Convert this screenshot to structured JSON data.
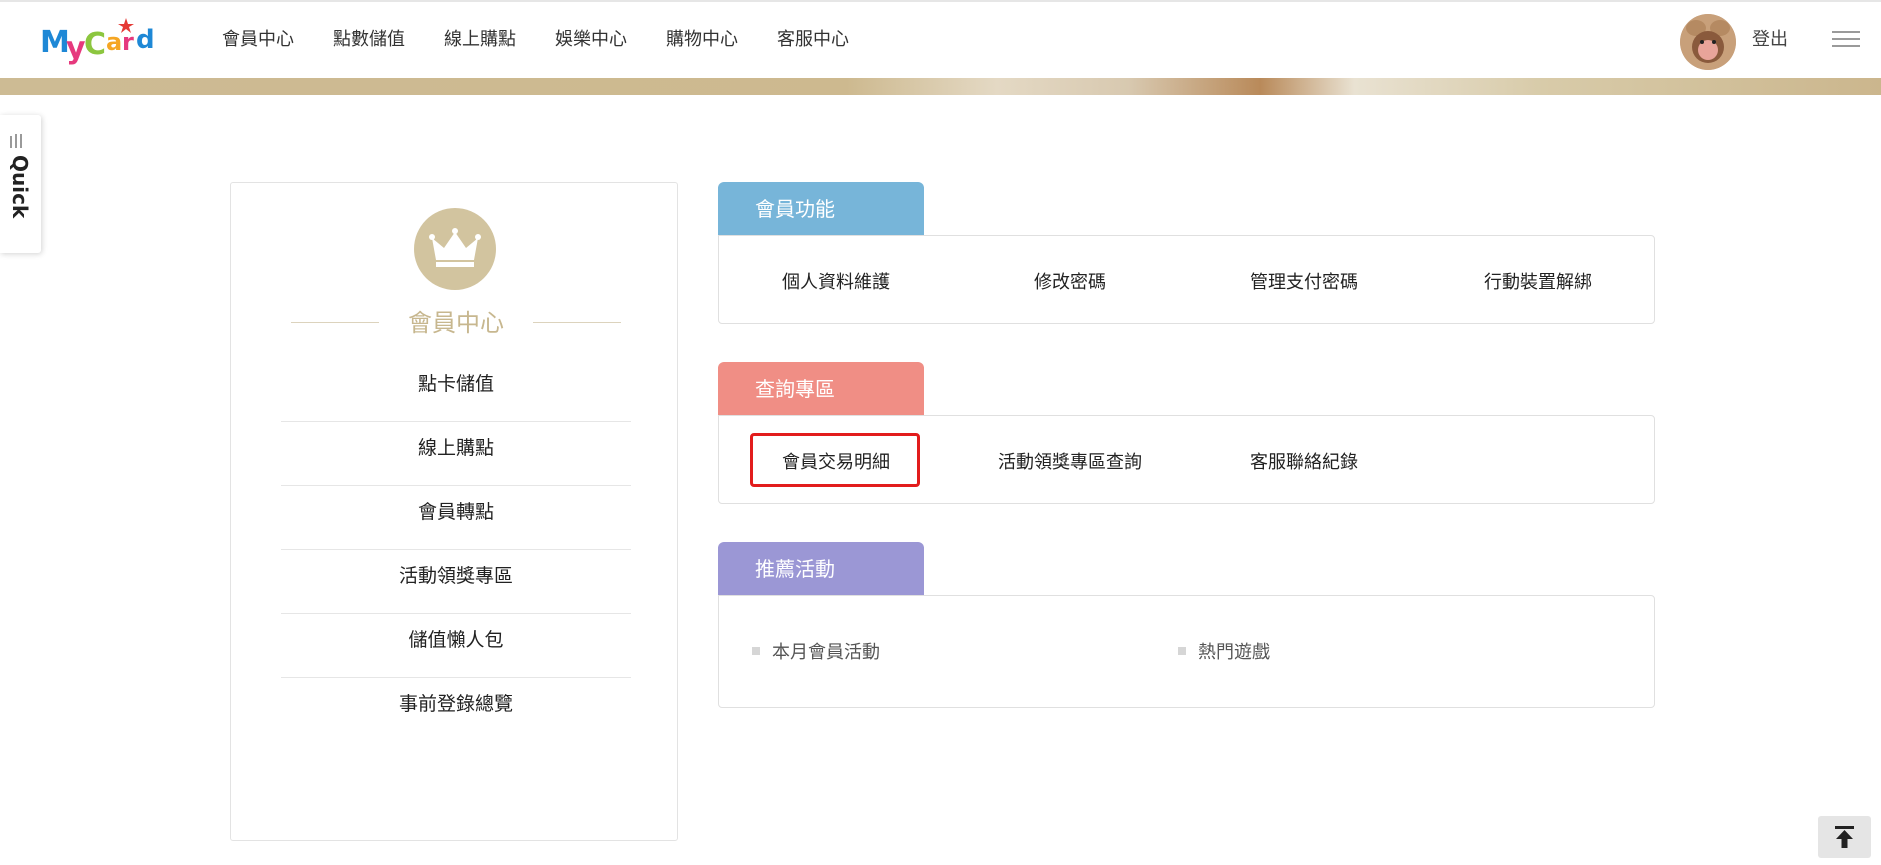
{
  "header": {
    "logo_text": "MyCard",
    "nav": [
      "會員中心",
      "點數儲值",
      "線上購點",
      "娛樂中心",
      "購物中心",
      "客服中心"
    ],
    "logout_label": "登出"
  },
  "quick": {
    "label": "Quick"
  },
  "member_center": {
    "title": "會員中心",
    "items": [
      "點卡儲值",
      "線上購點",
      "會員轉點",
      "活動領獎專區",
      "儲值懶人包",
      "事前登錄總覽"
    ]
  },
  "sections": {
    "member_functions": {
      "title": "會員功能",
      "color": "#77b5d9",
      "links": [
        "個人資料維護",
        "修改密碼",
        "管理支付密碼",
        "行動裝置解綁"
      ]
    },
    "query_zone": {
      "title": "查詢專區",
      "color": "#f08e85",
      "links": [
        "會員交易明細",
        "活動領獎專區查詢",
        "客服聯絡紀錄"
      ],
      "highlighted": "會員交易明細"
    },
    "recommended": {
      "title": "推薦活動",
      "color": "#9b97d5",
      "items": [
        "本月會員活動",
        "熱門遊戲"
      ]
    }
  },
  "icons": {
    "crown": "crown-icon",
    "back_to_top": "arrow-up-to-top-icon",
    "menu": "hamburger-menu-icon"
  }
}
